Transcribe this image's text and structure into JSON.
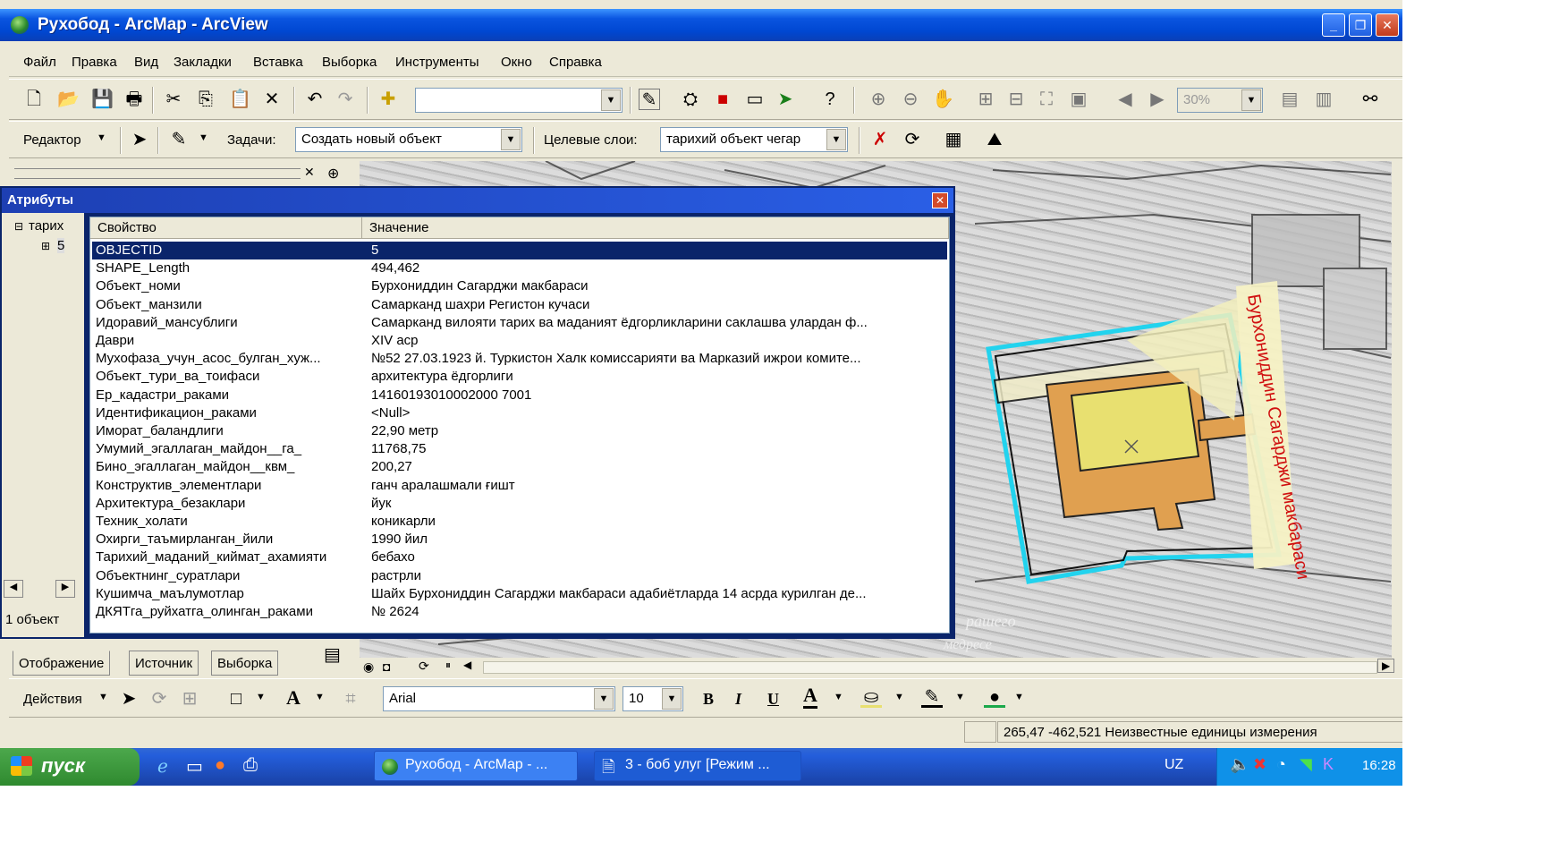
{
  "window": {
    "title": "Рухобод - ArcMap - ArcView"
  },
  "menu": [
    "Файл",
    "Правка",
    "Вид",
    "Закладки",
    "Вставка",
    "Выборка",
    "Инструменты",
    "Окно",
    "Справка"
  ],
  "toolbar": {
    "zoom": "30%"
  },
  "editor": {
    "editor_label": "Редактор",
    "task_label": "Задачи:",
    "task_value": "Создать новый объект",
    "target_label": "Целевые слои:",
    "target_value": "тарихий объект чегар"
  },
  "attributes": {
    "title": "Атрибуты",
    "tree_layer": "тарих",
    "tree_feature": "5",
    "count_label": "1 объект",
    "columns": [
      "Свойство",
      "Значение"
    ],
    "rows": [
      {
        "property": "OBJECTID",
        "value": "5",
        "selected": true
      },
      {
        "property": "SHAPE_Length",
        "value": "494,462"
      },
      {
        "property": "Объект_номи",
        "value": "Бурхониддин Сагарджи макбараси"
      },
      {
        "property": "Объект_манзили",
        "value": "Самарканд шахри Регистон кучаси"
      },
      {
        "property": "Идоравий_мансублиги",
        "value": "Самарканд вилояти тарих ва маданият ёдгорликларини саклашва улардан ф..."
      },
      {
        "property": "Даври",
        "value": "XIV аср"
      },
      {
        "property": "Мухофаза_учун_асос_булган_хуж...",
        "value": "№52 27.03.1923 й. Туркистон Халк комиссарияти ва Марказий ижрои комите..."
      },
      {
        "property": "Объект_тури_ва_тоифаси",
        "value": "архитектура ёдгорлиги"
      },
      {
        "property": "Ер_кадастри_раками",
        "value": "14160193010002000 7001"
      },
      {
        "property": "Идентификацион_раками",
        "value": "<Null>"
      },
      {
        "property": "Иморат_баландлиги",
        "value": "22,90 метр"
      },
      {
        "property": "Умумий_эгаллаган_майдон__га_",
        "value": "11768,75"
      },
      {
        "property": "Бино_эгаллаган_майдон__квм_",
        "value": "200,27"
      },
      {
        "property": "Конструктив_элементлари",
        "value": "ганч аралашмали ғишт"
      },
      {
        "property": "Архитектура_безаклари",
        "value": "йук"
      },
      {
        "property": "Техник_холати",
        "value": "коникарли"
      },
      {
        "property": "Охирги_таъмирланган_йили",
        "value": "1990 йил"
      },
      {
        "property": "Тарихий_маданий_киймат_ахамияти",
        "value": "бебахо"
      },
      {
        "property": "Объектнинг_суратлари",
        "value": "растрли"
      },
      {
        "property": "Кушимча_маълумотлар",
        "value": "Шайх Бурхониддин Сагарджи макбараси адабиётларда 14 асрда курилган де..."
      },
      {
        "property": "ДКЯТга_руйхатга_олинган_раками",
        "value": "№ 2624"
      }
    ]
  },
  "toc_tabs": [
    "Отображение",
    "Источник",
    "Выборка"
  ],
  "map": {
    "label": "Бурхониддин Сагарджи макбараси",
    "label_color": "#d01010",
    "map_texts": [
      "рашего",
      "медресе"
    ]
  },
  "draw": {
    "actions_label": "Действия",
    "font": "Arial",
    "size": "10",
    "bold": "B",
    "italic": "I",
    "underline": "U",
    "text_tool": "A"
  },
  "status": {
    "coords": "265,47  -462,521 Неизвестные единицы измерения"
  },
  "taskbar": {
    "start": "пуск",
    "tasks": [
      "Рухобод - ArcMap - ...",
      "3 - боб улуг [Режим ..."
    ],
    "lang": "UZ",
    "time": "16:28"
  },
  "colors": {
    "titlebar": "#0047d1",
    "selection": "#0a246a",
    "parcel_outline": "#22d3ee",
    "building_fill": "#e0a050",
    "yard_fill": "#e8e070"
  }
}
